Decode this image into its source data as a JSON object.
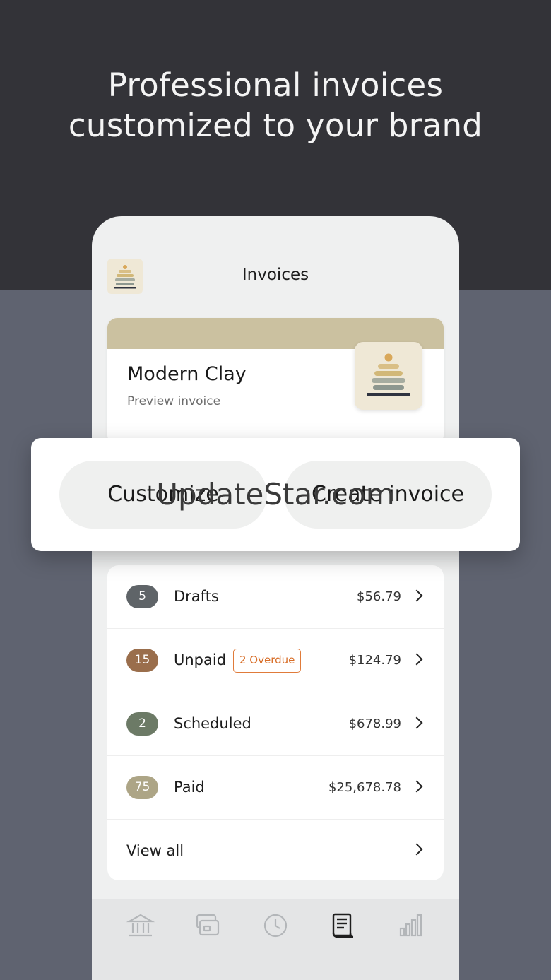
{
  "headline": {
    "line1": "Professional invoices",
    "line2": "customized to your brand"
  },
  "header": {
    "title": "Invoices",
    "logo_icon": "bowl-logo-icon"
  },
  "brand_card": {
    "name": "Modern Clay",
    "preview_label": "Preview invoice",
    "accent_color": "#cbc1a0"
  },
  "actions": {
    "customize_label": "Customize",
    "create_label": "Create invoice"
  },
  "watermark": "UpdateStar.com",
  "statuses": [
    {
      "count": "5",
      "label": "Drafts",
      "amount": "$56.79",
      "color": "#5f6468"
    },
    {
      "count": "15",
      "label": "Unpaid",
      "amount": "$124.79",
      "color": "#9a6e4c",
      "tag": "2 Overdue"
    },
    {
      "count": "2",
      "label": "Scheduled",
      "amount": "$678.99",
      "color": "#6c7a66"
    },
    {
      "count": "75",
      "label": "Paid",
      "amount": "$25,678.78",
      "color": "#ada586"
    }
  ],
  "view_all_label": "View all",
  "tabbar": {
    "icons": [
      "bank-icon",
      "card-icon",
      "clock-icon",
      "invoice-icon",
      "chart-icon"
    ],
    "active_index": 3
  }
}
